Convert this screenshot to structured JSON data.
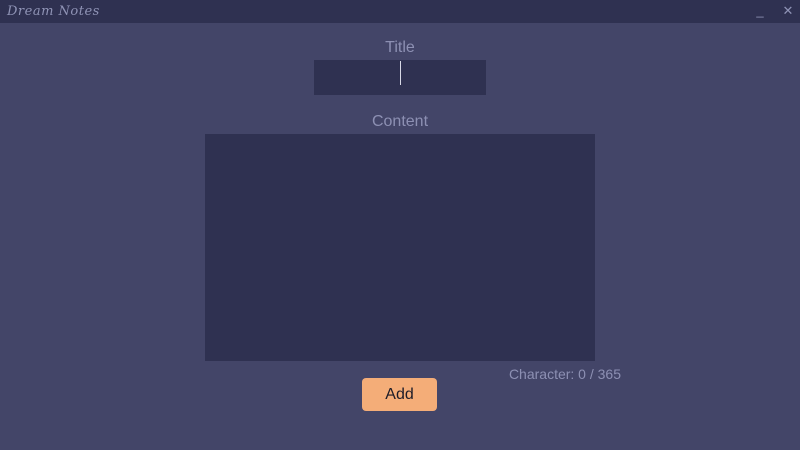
{
  "window": {
    "title": "Dream Notes",
    "minimize_label": "_",
    "close_label": "✕"
  },
  "form": {
    "title_label": "Title",
    "title_value": "",
    "content_label": "Content",
    "content_value": "",
    "char_count": "Character: 0 / 365",
    "add_label": "Add"
  },
  "colors": {
    "background": "#434568",
    "panel": "#2f3151",
    "label_text": "#8d90b3",
    "accent_button": "#f4ad78"
  }
}
